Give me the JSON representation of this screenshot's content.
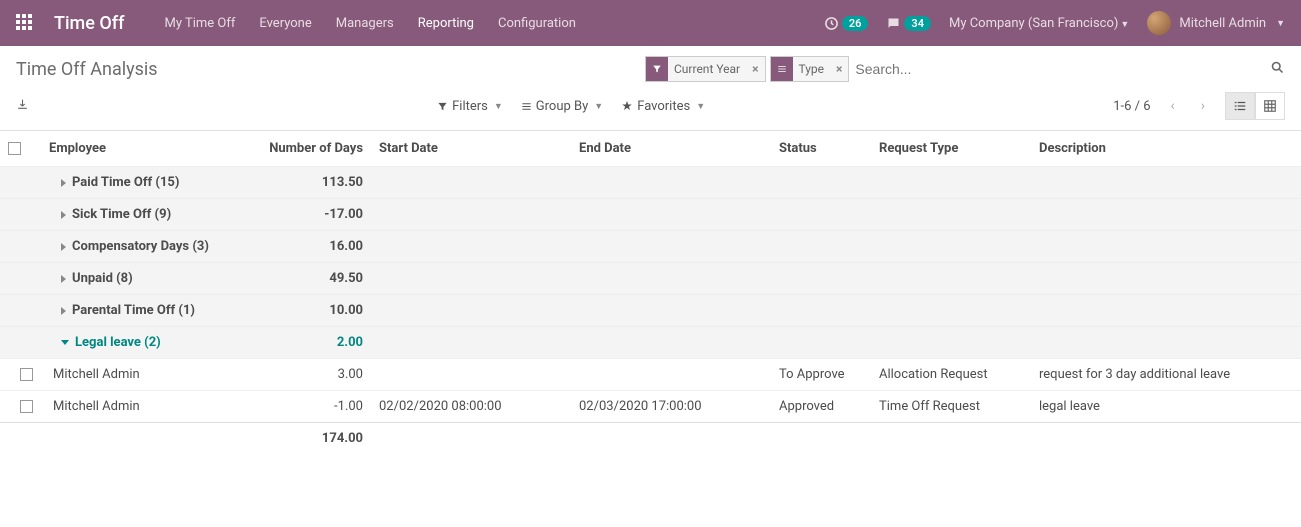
{
  "topbar": {
    "app_title": "Time Off",
    "nav": [
      "My Time Off",
      "Everyone",
      "Managers",
      "Reporting",
      "Configuration"
    ],
    "activity_count": "26",
    "messages_count": "34",
    "company": "My Company (San Francisco)",
    "user_name": "Mitchell Admin"
  },
  "breadcrumb": "Time Off Analysis",
  "search": {
    "facets": [
      {
        "icon": "filter",
        "label": "Current Year"
      },
      {
        "icon": "group",
        "label": "Type"
      }
    ],
    "placeholder": "Search..."
  },
  "toolbar": {
    "filters": "Filters",
    "groupby": "Group By",
    "favorites": "Favorites",
    "pager": "1-6 / 6"
  },
  "table": {
    "headers": {
      "employee": "Employee",
      "days": "Number of Days",
      "start": "Start Date",
      "end": "End Date",
      "status": "Status",
      "type": "Request Type",
      "desc": "Description"
    },
    "groups": [
      {
        "label": "Paid Time Off (15)",
        "days": "113.50",
        "expanded": false
      },
      {
        "label": "Sick Time Off (9)",
        "days": "-17.00",
        "expanded": false
      },
      {
        "label": "Compensatory Days (3)",
        "days": "16.00",
        "expanded": false
      },
      {
        "label": "Unpaid (8)",
        "days": "49.50",
        "expanded": false
      },
      {
        "label": "Parental Time Off (1)",
        "days": "10.00",
        "expanded": false
      },
      {
        "label": "Legal leave (2)",
        "days": "2.00",
        "expanded": true,
        "rows": [
          {
            "employee": "Mitchell Admin",
            "days": "3.00",
            "start": "",
            "end": "",
            "status": "To Approve",
            "type": "Allocation Request",
            "desc": "request for 3 day additional leave"
          },
          {
            "employee": "Mitchell Admin",
            "days": "-1.00",
            "start": "02/02/2020 08:00:00",
            "end": "02/03/2020 17:00:00",
            "status": "Approved",
            "type": "Time Off Request",
            "desc": "legal leave"
          }
        ]
      }
    ],
    "total_days": "174.00"
  }
}
